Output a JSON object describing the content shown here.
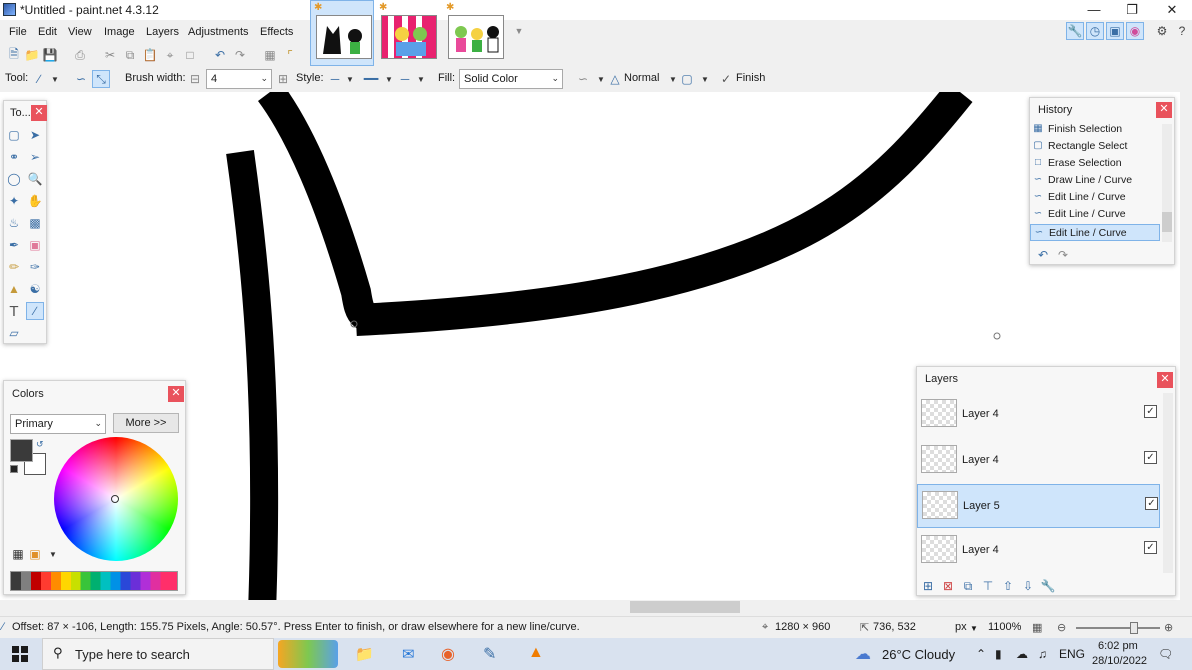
{
  "window": {
    "title": "*Untitled - paint.net 4.3.12"
  },
  "menu": [
    "File",
    "Edit",
    "View",
    "Image",
    "Layers",
    "Adjustments",
    "Effects"
  ],
  "toolbar": {
    "tool_label": "Tool:",
    "brush_width_label": "Brush width:",
    "brush_width_value": "4",
    "style_label": "Style:",
    "fill_label": "Fill:",
    "fill_value": "Solid Color",
    "blend_mode": "Normal",
    "finish_label": "Finish"
  },
  "tools_panel": {
    "title": "To..."
  },
  "history": {
    "title": "History",
    "items": [
      {
        "label": "Finish Selection",
        "icon": "finish-selection-icon"
      },
      {
        "label": "Rectangle Select",
        "icon": "rectangle-select-icon"
      },
      {
        "label": "Erase Selection",
        "icon": "erase-selection-icon"
      },
      {
        "label": "Draw Line / Curve",
        "icon": "line-curve-icon"
      },
      {
        "label": "Edit Line / Curve",
        "icon": "line-curve-icon"
      },
      {
        "label": "Edit Line / Curve",
        "icon": "line-curve-icon"
      },
      {
        "label": "Edit Line / Curve",
        "icon": "line-curve-icon",
        "selected": true
      }
    ]
  },
  "colors": {
    "title": "Colors",
    "mode": "Primary",
    "more_button": "More >>",
    "primary_color": "#3a3a3a",
    "secondary_color": "#ffffff"
  },
  "layers": {
    "title": "Layers",
    "items": [
      {
        "name": "Layer 4",
        "checked": true
      },
      {
        "name": "Layer 4",
        "checked": true
      },
      {
        "name": "Layer 5",
        "checked": true,
        "selected": true
      },
      {
        "name": "Layer 4",
        "checked": true
      }
    ]
  },
  "status": {
    "message": "Offset: 87 × -106, Length: 155.75 Pixels, Angle: 50.57°. Press Enter to finish, or draw elsewhere for a new line/curve.",
    "image_size": "1280 × 960",
    "cursor_pos": "736, 532",
    "units": "px",
    "zoom": "1100%"
  },
  "taskbar": {
    "search_placeholder": "Type here to search",
    "weather": "26°C  Cloudy",
    "language": "ENG",
    "time": "6:02 pm",
    "date": "28/10/2022"
  },
  "accent": {
    "selection": "#cfe5fb",
    "selection_border": "#7fb3e8",
    "close": "#e9525c"
  }
}
